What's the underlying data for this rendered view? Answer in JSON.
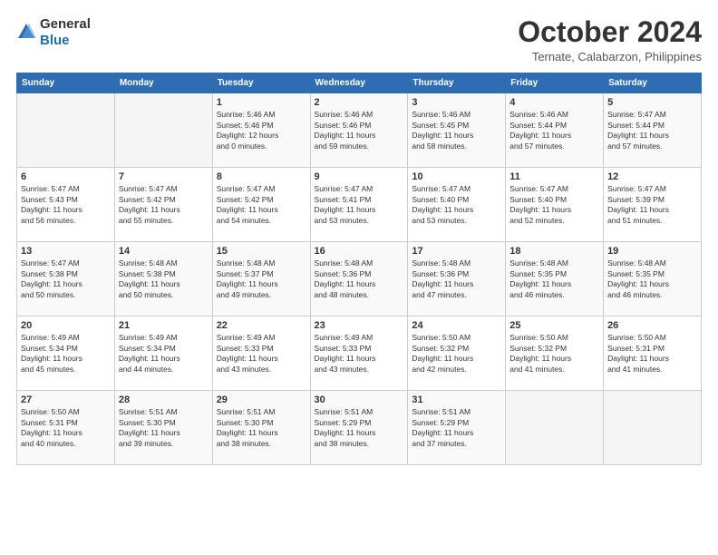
{
  "header": {
    "logo_line1": "General",
    "logo_line2": "Blue",
    "month": "October 2024",
    "location": "Ternate, Calabarzon, Philippines"
  },
  "weekdays": [
    "Sunday",
    "Monday",
    "Tuesday",
    "Wednesday",
    "Thursday",
    "Friday",
    "Saturday"
  ],
  "weeks": [
    [
      {
        "day": "",
        "info": ""
      },
      {
        "day": "",
        "info": ""
      },
      {
        "day": "1",
        "info": "Sunrise: 5:46 AM\nSunset: 5:46 PM\nDaylight: 12 hours\nand 0 minutes."
      },
      {
        "day": "2",
        "info": "Sunrise: 5:46 AM\nSunset: 5:46 PM\nDaylight: 11 hours\nand 59 minutes."
      },
      {
        "day": "3",
        "info": "Sunrise: 5:46 AM\nSunset: 5:45 PM\nDaylight: 11 hours\nand 58 minutes."
      },
      {
        "day": "4",
        "info": "Sunrise: 5:46 AM\nSunset: 5:44 PM\nDaylight: 11 hours\nand 57 minutes."
      },
      {
        "day": "5",
        "info": "Sunrise: 5:47 AM\nSunset: 5:44 PM\nDaylight: 11 hours\nand 57 minutes."
      }
    ],
    [
      {
        "day": "6",
        "info": "Sunrise: 5:47 AM\nSunset: 5:43 PM\nDaylight: 11 hours\nand 56 minutes."
      },
      {
        "day": "7",
        "info": "Sunrise: 5:47 AM\nSunset: 5:42 PM\nDaylight: 11 hours\nand 55 minutes."
      },
      {
        "day": "8",
        "info": "Sunrise: 5:47 AM\nSunset: 5:42 PM\nDaylight: 11 hours\nand 54 minutes."
      },
      {
        "day": "9",
        "info": "Sunrise: 5:47 AM\nSunset: 5:41 PM\nDaylight: 11 hours\nand 53 minutes."
      },
      {
        "day": "10",
        "info": "Sunrise: 5:47 AM\nSunset: 5:40 PM\nDaylight: 11 hours\nand 53 minutes."
      },
      {
        "day": "11",
        "info": "Sunrise: 5:47 AM\nSunset: 5:40 PM\nDaylight: 11 hours\nand 52 minutes."
      },
      {
        "day": "12",
        "info": "Sunrise: 5:47 AM\nSunset: 5:39 PM\nDaylight: 11 hours\nand 51 minutes."
      }
    ],
    [
      {
        "day": "13",
        "info": "Sunrise: 5:47 AM\nSunset: 5:38 PM\nDaylight: 11 hours\nand 50 minutes."
      },
      {
        "day": "14",
        "info": "Sunrise: 5:48 AM\nSunset: 5:38 PM\nDaylight: 11 hours\nand 50 minutes."
      },
      {
        "day": "15",
        "info": "Sunrise: 5:48 AM\nSunset: 5:37 PM\nDaylight: 11 hours\nand 49 minutes."
      },
      {
        "day": "16",
        "info": "Sunrise: 5:48 AM\nSunset: 5:36 PM\nDaylight: 11 hours\nand 48 minutes."
      },
      {
        "day": "17",
        "info": "Sunrise: 5:48 AM\nSunset: 5:36 PM\nDaylight: 11 hours\nand 47 minutes."
      },
      {
        "day": "18",
        "info": "Sunrise: 5:48 AM\nSunset: 5:35 PM\nDaylight: 11 hours\nand 46 minutes."
      },
      {
        "day": "19",
        "info": "Sunrise: 5:48 AM\nSunset: 5:35 PM\nDaylight: 11 hours\nand 46 minutes."
      }
    ],
    [
      {
        "day": "20",
        "info": "Sunrise: 5:49 AM\nSunset: 5:34 PM\nDaylight: 11 hours\nand 45 minutes."
      },
      {
        "day": "21",
        "info": "Sunrise: 5:49 AM\nSunset: 5:34 PM\nDaylight: 11 hours\nand 44 minutes."
      },
      {
        "day": "22",
        "info": "Sunrise: 5:49 AM\nSunset: 5:33 PM\nDaylight: 11 hours\nand 43 minutes."
      },
      {
        "day": "23",
        "info": "Sunrise: 5:49 AM\nSunset: 5:33 PM\nDaylight: 11 hours\nand 43 minutes."
      },
      {
        "day": "24",
        "info": "Sunrise: 5:50 AM\nSunset: 5:32 PM\nDaylight: 11 hours\nand 42 minutes."
      },
      {
        "day": "25",
        "info": "Sunrise: 5:50 AM\nSunset: 5:32 PM\nDaylight: 11 hours\nand 41 minutes."
      },
      {
        "day": "26",
        "info": "Sunrise: 5:50 AM\nSunset: 5:31 PM\nDaylight: 11 hours\nand 41 minutes."
      }
    ],
    [
      {
        "day": "27",
        "info": "Sunrise: 5:50 AM\nSunset: 5:31 PM\nDaylight: 11 hours\nand 40 minutes."
      },
      {
        "day": "28",
        "info": "Sunrise: 5:51 AM\nSunset: 5:30 PM\nDaylight: 11 hours\nand 39 minutes."
      },
      {
        "day": "29",
        "info": "Sunrise: 5:51 AM\nSunset: 5:30 PM\nDaylight: 11 hours\nand 38 minutes."
      },
      {
        "day": "30",
        "info": "Sunrise: 5:51 AM\nSunset: 5:29 PM\nDaylight: 11 hours\nand 38 minutes."
      },
      {
        "day": "31",
        "info": "Sunrise: 5:51 AM\nSunset: 5:29 PM\nDaylight: 11 hours\nand 37 minutes."
      },
      {
        "day": "",
        "info": ""
      },
      {
        "day": "",
        "info": ""
      }
    ]
  ]
}
